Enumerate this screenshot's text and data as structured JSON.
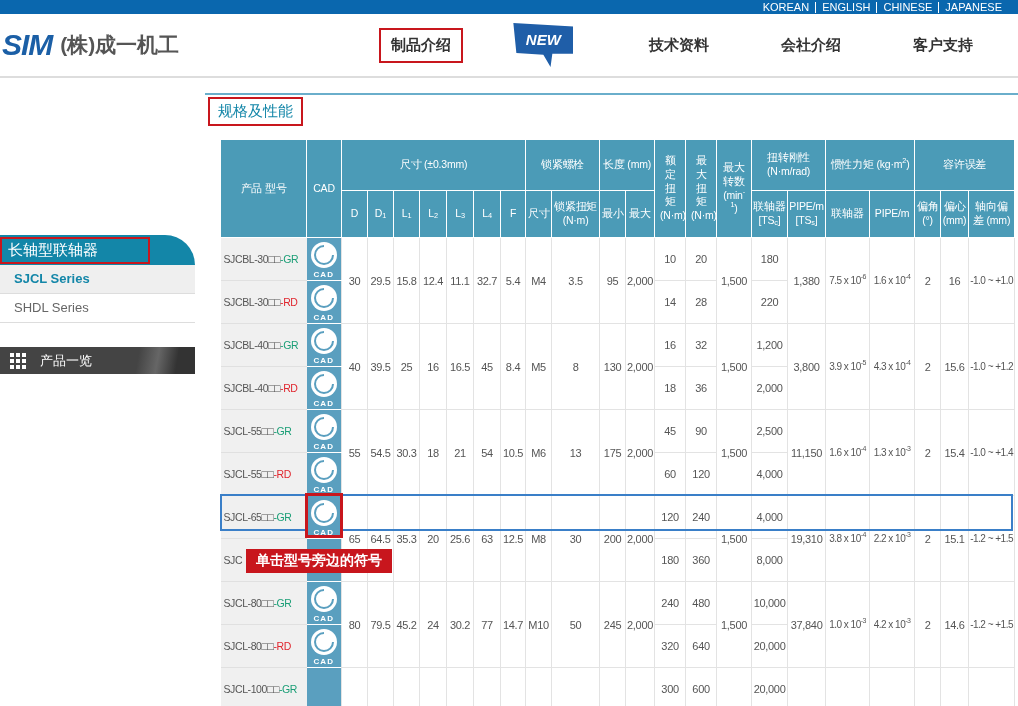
{
  "top_bar": {
    "languages": [
      "KOREAN",
      "ENGLISH",
      "CHINESE",
      "JAPANESE"
    ]
  },
  "header": {
    "logo": "SIM",
    "company": "(株)成一机工",
    "nav": [
      {
        "label": "制品介绍",
        "kind": "link",
        "annotated": true
      },
      {
        "label": "NEW",
        "kind": "badge",
        "annotated": false
      },
      {
        "label": "技术资料",
        "kind": "link",
        "annotated": false
      },
      {
        "label": "会社介绍",
        "kind": "link",
        "annotated": false
      },
      {
        "label": "客户支持",
        "kind": "link",
        "annotated": false
      }
    ]
  },
  "sidebar": {
    "heading": {
      "label": "长轴型联轴器",
      "annotated": true
    },
    "items": [
      {
        "label": "SJCL Series",
        "selected": true
      },
      {
        "label": "SHDL Series",
        "selected": false
      }
    ],
    "all_products": "产品一览"
  },
  "page_title": {
    "label": "规格及性能",
    "annotated": true
  },
  "table": {
    "columns": [
      {
        "label": "产品 型号"
      },
      {
        "label": "CAD"
      },
      {
        "label": "尺寸 (±0.3mm)",
        "sub": [
          "D",
          "D$_{1}$",
          "L$_{1}$",
          "L$_{2}$",
          "L$_{3}$",
          "L$_{4}$",
          "F"
        ]
      },
      {
        "label": "锁紧螺栓",
        "sub": [
          "尺寸",
          "锁紧扭矩 (N·m)"
        ]
      },
      {
        "label": "长度 (mm)",
        "sub": [
          "最小",
          "最大"
        ]
      },
      {
        "label": "额定扭矩 (N·m)"
      },
      {
        "label": "最大扭矩 (N·m)"
      },
      {
        "label": "最大转数 (min$^{-1}$)"
      },
      {
        "label": "扭转刚性 (N·m/rad)",
        "sub": [
          "联轴器 [TS$_{c}$]",
          "PIPE/m [TS$_{s}$]"
        ]
      },
      {
        "label": "惯性力矩 (kg·m$^{2}$)",
        "sub": [
          "联轴器",
          "PIPE/m"
        ]
      },
      {
        "label": "容许误差",
        "sub": [
          "偏角 (°)",
          "偏心 (mm)",
          "轴向偏差 (mm)"
        ]
      }
    ],
    "groups": [
      {
        "dims": [
          "30",
          "29.5",
          "15.8",
          "12.4",
          "11.1",
          "32.7",
          "5.4",
          "M4",
          "3.5",
          "95",
          "2,000"
        ],
        "speed": "1,500",
        "tss": "1,380",
        "inertia_coupling": "7.5 x 10$^{-6}$",
        "inertia_pipe": "1.6 x 10$^{-4}$",
        "angle": "2",
        "eccentric": "16",
        "axial": "-1.0 ~ +1.0",
        "rows": [
          {
            "model": "SJCBL-30□□",
            "suffix": "-GR",
            "color": "#1a9e76",
            "cad": "CAD",
            "rated": "10",
            "max_torque": "20",
            "tsc": "180",
            "highlighted": false,
            "annotated": false
          },
          {
            "model": "SJCBL-30□□",
            "suffix": "-RD",
            "color": "#e0262e",
            "cad": "CAD",
            "rated": "14",
            "max_torque": "28",
            "tsc": "220",
            "highlighted": false,
            "annotated": false
          }
        ]
      },
      {
        "dims": [
          "40",
          "39.5",
          "25",
          "16",
          "16.5",
          "45",
          "8.4",
          "M5",
          "8",
          "130",
          "2,000"
        ],
        "speed": "1,500",
        "tss": "3,800",
        "inertia_coupling": "3.9 x 10$^{-5}$",
        "inertia_pipe": "4.3 x 10$^{-4}$",
        "angle": "2",
        "eccentric": "15.6",
        "axial": "-1.0 ~ +1.2",
        "rows": [
          {
            "model": "SJCBL-40□□",
            "suffix": "-GR",
            "color": "#1a9e76",
            "cad": "CAD",
            "rated": "16",
            "max_torque": "32",
            "tsc": "1,200",
            "highlighted": false,
            "annotated": false
          },
          {
            "model": "SJCBL-40□□",
            "suffix": "-RD",
            "color": "#e0262e",
            "cad": "CAD",
            "rated": "18",
            "max_torque": "36",
            "tsc": "2,000",
            "highlighted": false,
            "annotated": false
          }
        ]
      },
      {
        "dims": [
          "55",
          "54.5",
          "30.3",
          "18",
          "21",
          "54",
          "10.5",
          "M6",
          "13",
          "175",
          "2,000"
        ],
        "speed": "1,500",
        "tss": "11,150",
        "inertia_coupling": "1.6 x 10$^{-4}$",
        "inertia_pipe": "1.3 x 10$^{-3}$",
        "angle": "2",
        "eccentric": "15.4",
        "axial": "-1.0 ~ +1.4",
        "rows": [
          {
            "model": "SJCL-55□□",
            "suffix": "-GR",
            "color": "#1a9e76",
            "cad": "CAD",
            "rated": "45",
            "max_torque": "90",
            "tsc": "2,500",
            "highlighted": false,
            "annotated": false
          },
          {
            "model": "SJCL-55□□",
            "suffix": "-RD",
            "color": "#e0262e",
            "cad": "CAD",
            "rated": "60",
            "max_torque": "120",
            "tsc": "4,000",
            "highlighted": false,
            "annotated": false
          }
        ]
      },
      {
        "dims": [
          "65",
          "64.5",
          "35.3",
          "20",
          "25.6",
          "63",
          "12.5",
          "M8",
          "30",
          "200",
          "2,000"
        ],
        "speed": "1,500",
        "tss": "19,310",
        "inertia_coupling": "3.8 x 10$^{-4}$",
        "inertia_pipe": "2.2 x 10$^{-3}$",
        "angle": "2",
        "eccentric": "15.1",
        "axial": "-1.2 ~ +1.5",
        "rows": [
          {
            "model": "SJCL-65□□",
            "suffix": "-GR",
            "color": "#1a9e76",
            "cad": "CAD",
            "rated": "120",
            "max_torque": "240",
            "tsc": "4,000",
            "highlighted": true,
            "annotated": true,
            "callout": "单击型号旁边的符号"
          },
          {
            "model": "SJC",
            "rated": "180",
            "max_torque": "360",
            "tsc": "8,000",
            "highlighted": false,
            "annotated": false
          }
        ]
      },
      {
        "dims": [
          "80",
          "79.5",
          "45.2",
          "24",
          "30.2",
          "77",
          "14.7",
          "M10",
          "50",
          "245",
          "2,000"
        ],
        "speed": "1,500",
        "tss": "37,840",
        "inertia_coupling": "1.0 x 10$^{-3}$",
        "inertia_pipe": "4.2 x 10$^{-3}$",
        "angle": "2",
        "eccentric": "14.6",
        "axial": "-1.2 ~ +1.5",
        "rows": [
          {
            "model": "SJCL-80□□",
            "suffix": "-GR",
            "color": "#1a9e76",
            "cad": "CAD",
            "rated": "240",
            "max_torque": "480",
            "tsc": "10,000",
            "highlighted": false,
            "annotated": false
          },
          {
            "model": "SJCL-80□□",
            "suffix": "-RD",
            "color": "#e0262e",
            "cad": "CAD",
            "rated": "320",
            "max_torque": "640",
            "tsc": "20,000",
            "highlighted": false,
            "annotated": false
          }
        ]
      },
      {
        "rows": [
          {
            "model": "SJCL-100□□",
            "suffix": "-GR",
            "color": "#1a9e76",
            "rated": "300",
            "max_torque": "600",
            "tsc": "20,000",
            "highlighted": false,
            "annotated": false
          }
        ]
      }
    ]
  }
}
